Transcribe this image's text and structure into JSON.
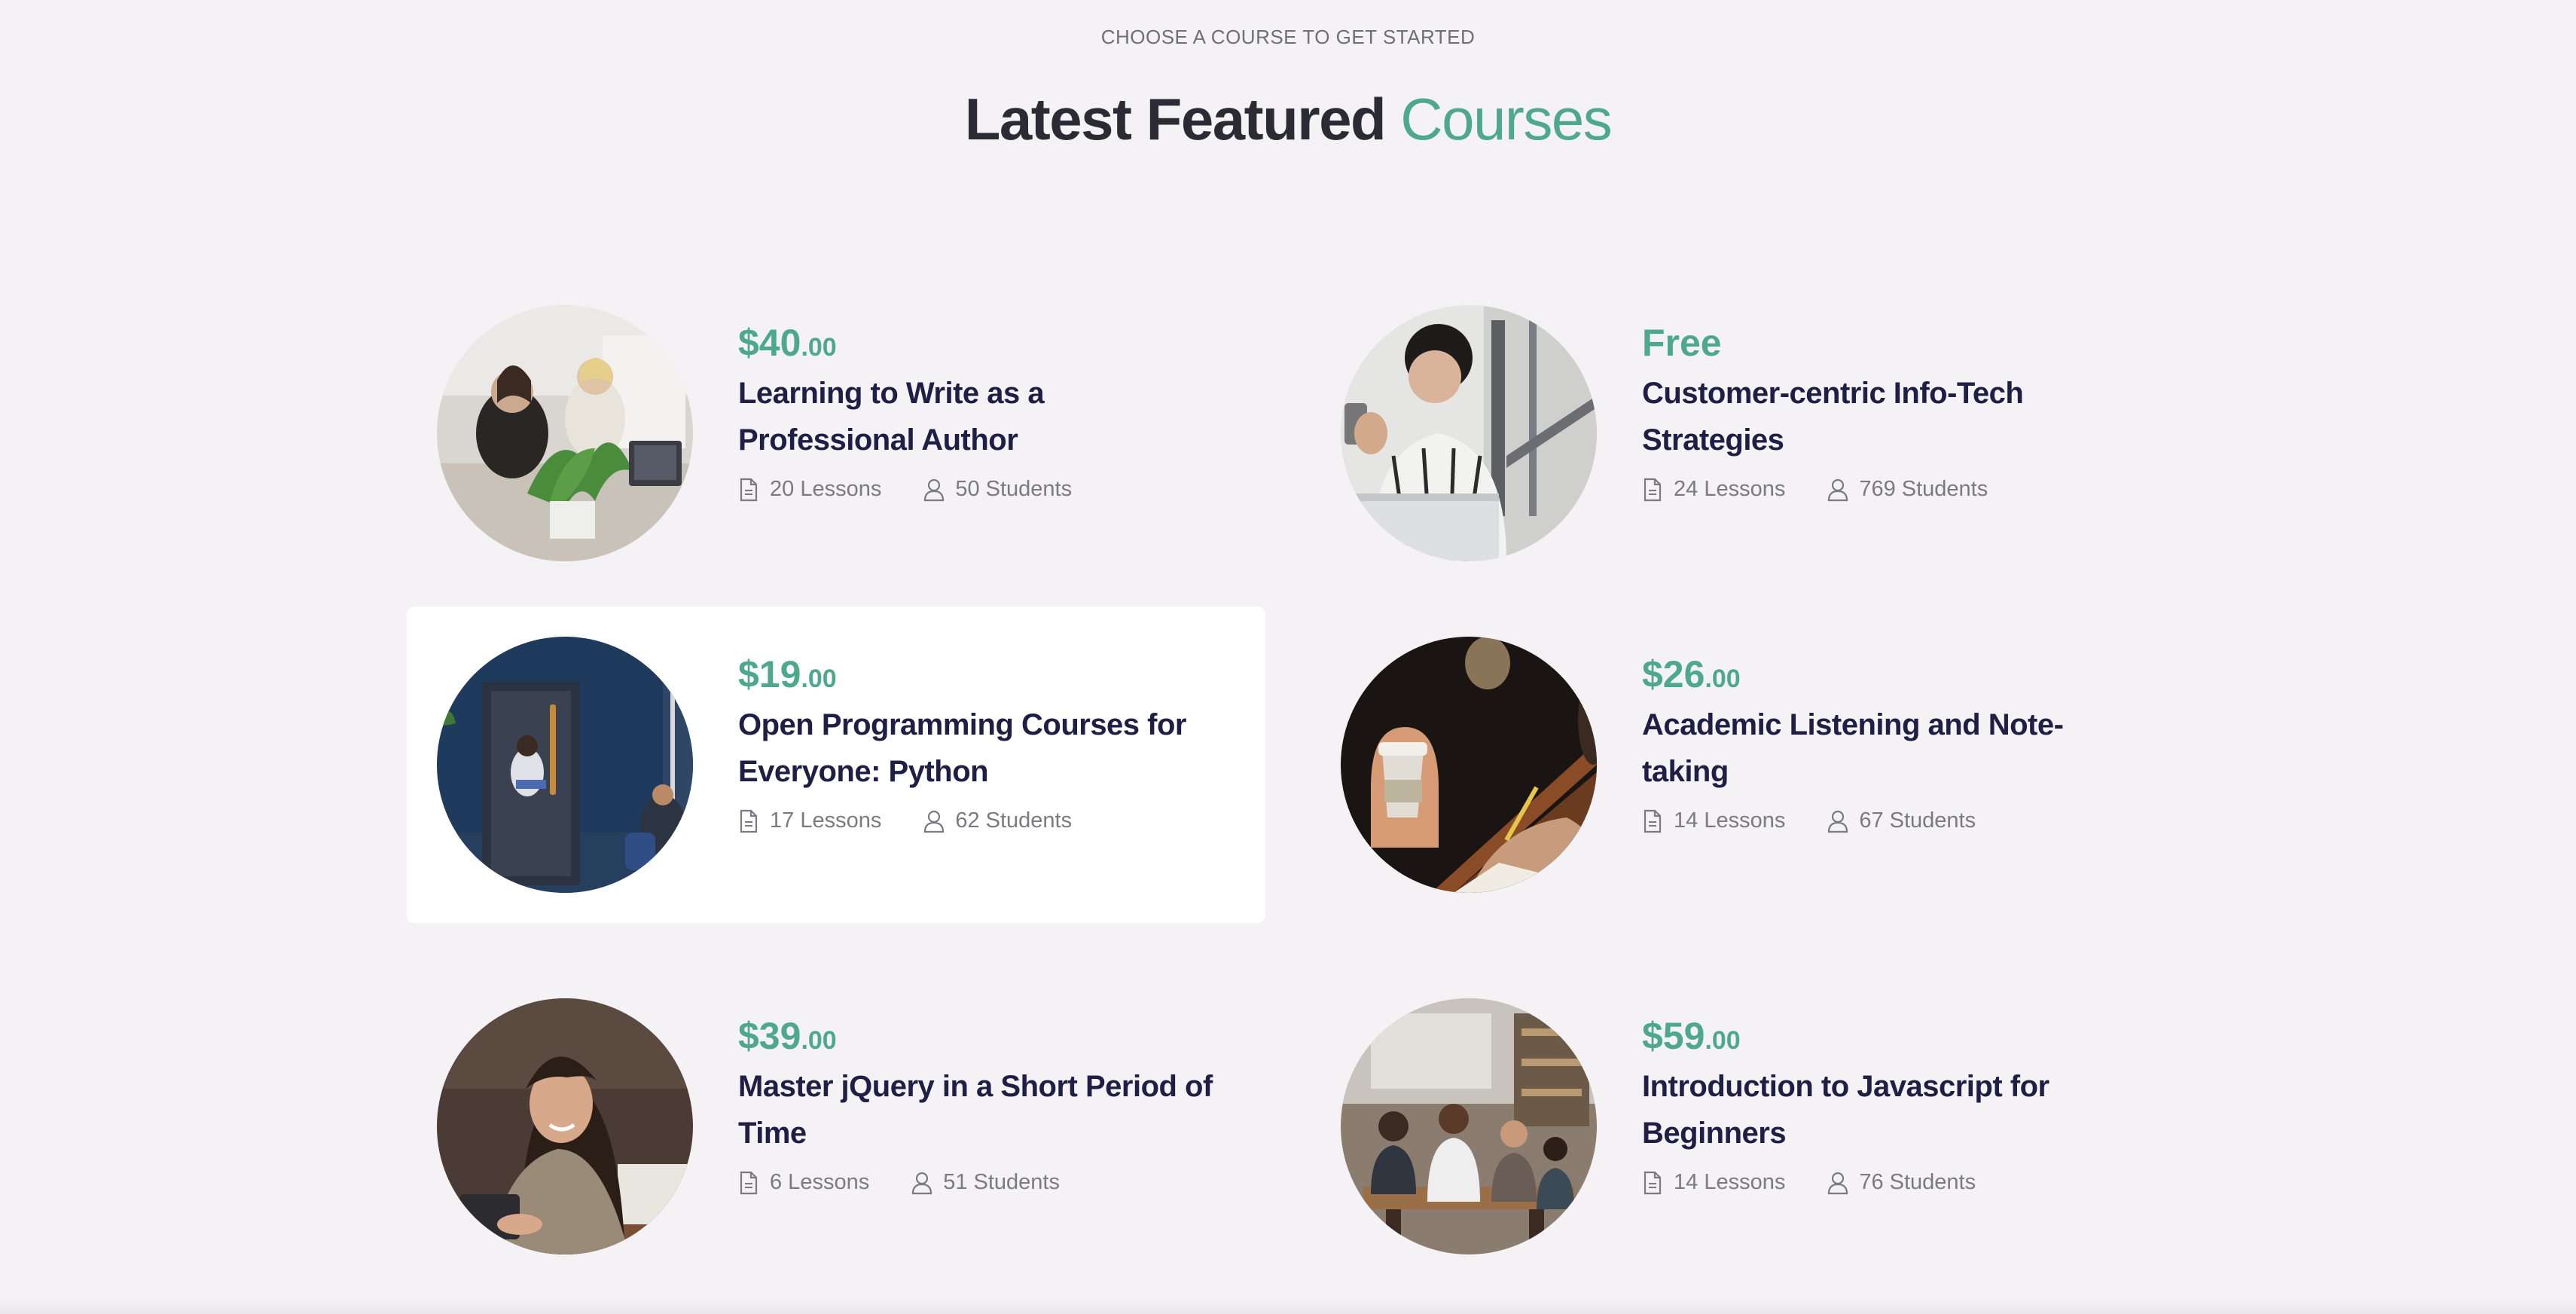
{
  "header": {
    "eyebrow": "CHOOSE A COURSE TO GET STARTED",
    "title_main": "Latest Featured",
    "title_accent": "Courses"
  },
  "colors": {
    "accent": "#4ea88c",
    "title": "#1f1f45",
    "background": "#f4f2f5"
  },
  "courses": [
    {
      "price_main": "$40",
      "price_cents": ".00",
      "title": "Learning to Write as a Professional Author",
      "lessons": "20 Lessons",
      "students": "50 Students",
      "image": "office-workers-with-plant"
    },
    {
      "price_main": "Free",
      "price_cents": "",
      "title": "Customer-centric Info-Tech Strategies",
      "lessons": "24 Lessons",
      "students": "769 Students",
      "image": "woman-with-phone-and-laptop"
    },
    {
      "price_main": "$19",
      "price_cents": ".00",
      "title": "Open Programming Courses for Everyone: Python",
      "lessons": "17 Lessons",
      "students": "62 Students",
      "image": "phone-booth-blue-wall"
    },
    {
      "price_main": "$26",
      "price_cents": ".00",
      "title": "Academic Listening and Note-taking",
      "lessons": "14 Lessons",
      "students": "67 Students",
      "image": "coffee-cup-and-notebook"
    },
    {
      "price_main": "$39",
      "price_cents": ".00",
      "title": "Master jQuery in a Short Period of Time",
      "lessons": "6 Lessons",
      "students": "51 Students",
      "image": "smiling-woman-at-laptop"
    },
    {
      "price_main": "$59",
      "price_cents": ".00",
      "title": "Introduction to Javascript for Beginners",
      "lessons": "14 Lessons",
      "students": "76 Students",
      "image": "group-meeting-in-cafe"
    }
  ]
}
